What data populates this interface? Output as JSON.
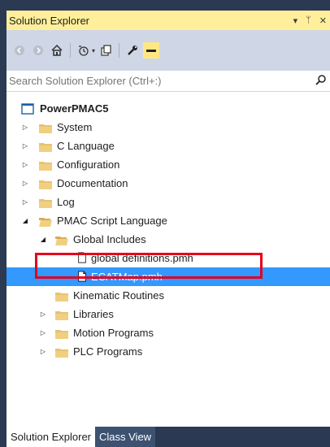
{
  "panel": {
    "title": "Solution Explorer",
    "dropdown_glyph": "▾",
    "pin_glyph": "ᛘ",
    "close_glyph": "✕"
  },
  "toolbar": {
    "buttons": [
      "back-icon",
      "forward-icon",
      "home-icon",
      "history-icon",
      "show-all-files-icon",
      "properties-icon",
      "preview-icon"
    ]
  },
  "search": {
    "placeholder": "Search Solution Explorer (Ctrl+:)",
    "value": ""
  },
  "tree": {
    "project": "PowerPMAC5",
    "items": [
      {
        "label": "System"
      },
      {
        "label": "C Language"
      },
      {
        "label": "Configuration"
      },
      {
        "label": "Documentation"
      },
      {
        "label": "Log"
      },
      {
        "label": "PMAC Script Language"
      },
      {
        "label": "Global Includes"
      },
      {
        "label": "global definitions.pmh"
      },
      {
        "label": "ECATMap.pmh"
      },
      {
        "label": "Kinematic Routines"
      },
      {
        "label": "Libraries"
      },
      {
        "label": "Motion Programs"
      },
      {
        "label": "PLC Programs"
      }
    ]
  },
  "tabs": {
    "active": "Solution Explorer",
    "inactive": "Class View"
  },
  "colors": {
    "title_bar": "#ffef9b",
    "toolbar": "#cfd6e5",
    "selection": "#3399ff",
    "highlight_box": "#e4001b",
    "folder": "#e8c26e"
  }
}
